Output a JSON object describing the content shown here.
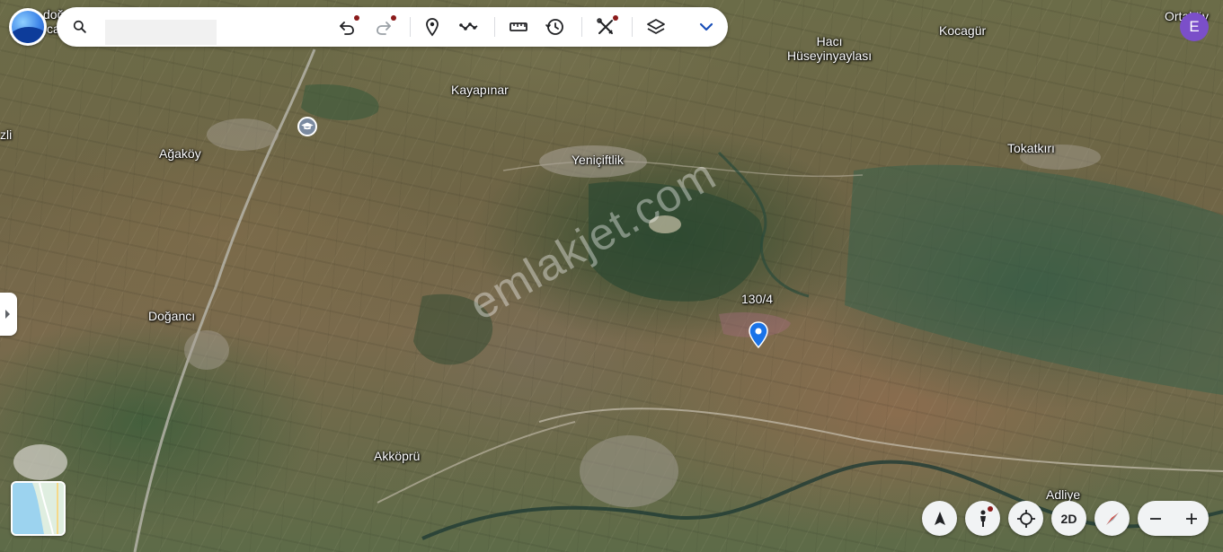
{
  "toolbar": {
    "search_placeholder": "",
    "buttons": [
      "undo-icon",
      "redo-icon",
      "pin-icon",
      "path-icon",
      "ruler-icon",
      "history-icon",
      "measure-icon",
      "layers-icon",
      "chevron-down-icon"
    ]
  },
  "user": {
    "initial": "E"
  },
  "places": {
    "doganci_top": "doğ",
    "ca": "ca",
    "hacihuseyin_l1": "Hacı",
    "hacihuseyin_l2": "Hüseyinyaylası",
    "kocagur": "Kocagür",
    "ortakoy": "Ortaköy",
    "kayapinar": "Kayapınar",
    "zli": "zli",
    "agakoy": "Ağaköy",
    "yeniciftlik": "Yeniçiftlik",
    "tokatkiri": "Tokatkırı",
    "parcel": "130/4",
    "doganci": "Doğancı",
    "akkopru": "Akköprü",
    "adliye": "Adliye"
  },
  "watermark": "emlakjet.com",
  "controls": {
    "view_2d": "2D"
  },
  "colors": {
    "avatar": "#7b4fc9",
    "pin": "#1a73e8",
    "toolbar_bg": "#ffffff"
  }
}
